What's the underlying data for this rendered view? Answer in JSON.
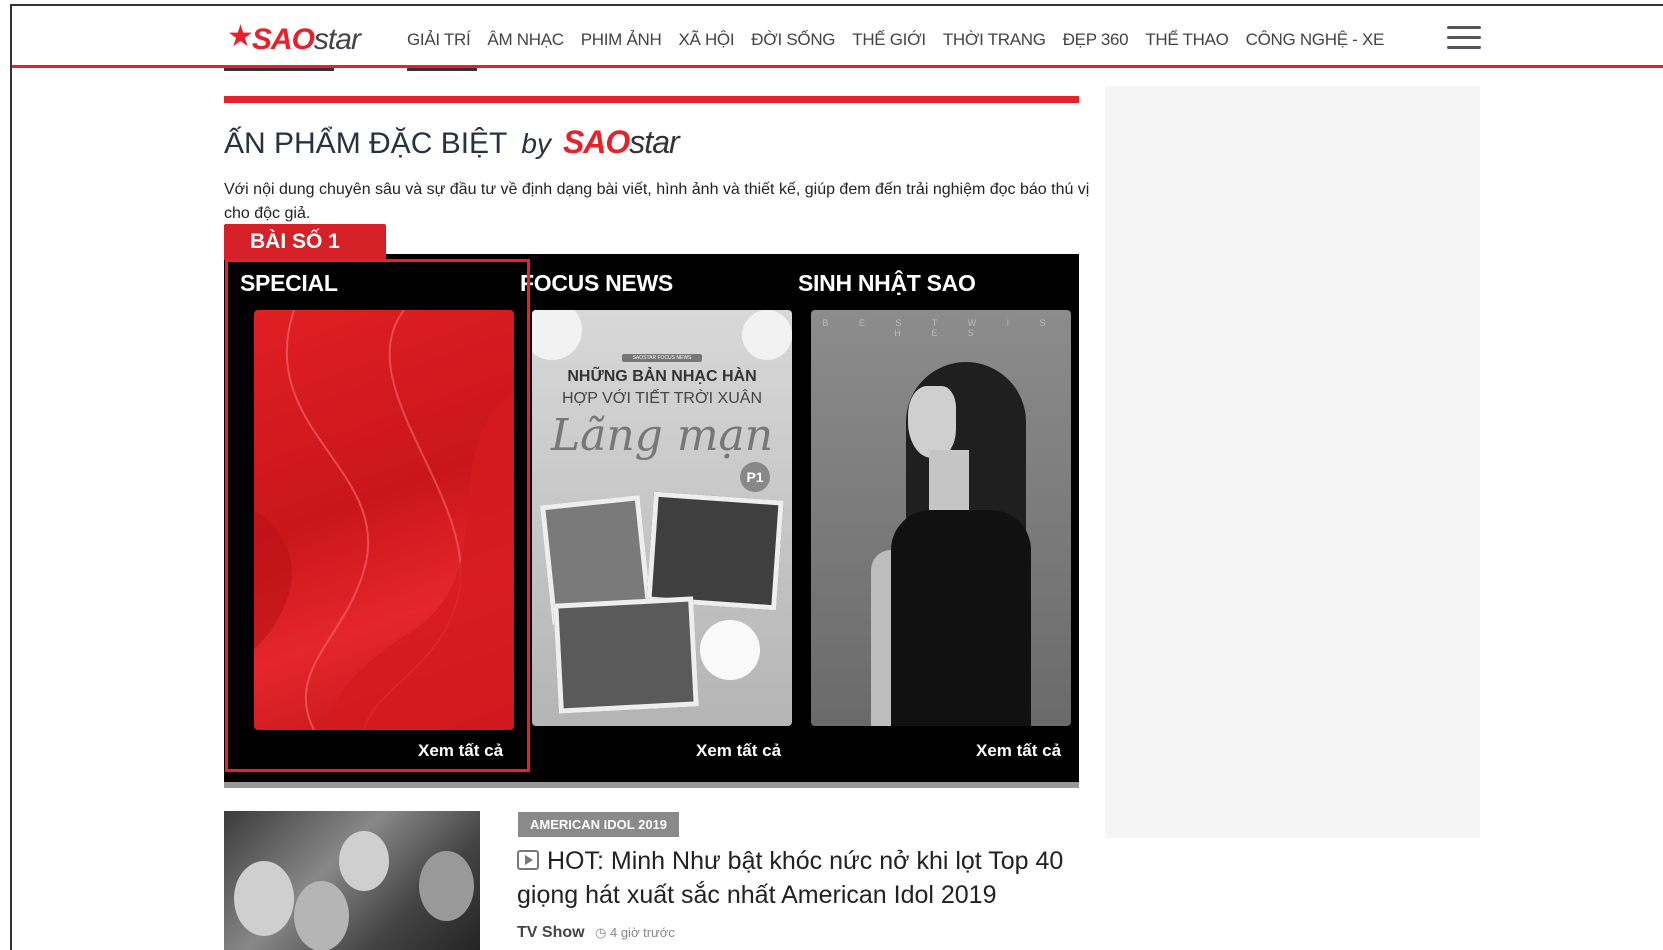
{
  "header": {
    "logo_sao": "SAO",
    "logo_star": "star",
    "nav": [
      "GIẢI TRÍ",
      "ÂM NHẠC",
      "PHIM ẢNH",
      "XÃ HỘI",
      "ĐỜI SỐNG",
      "THẾ GIỚI",
      "THỜI TRANG",
      "ĐẸP 360",
      "THỂ THAO",
      "CÔNG NGHỆ - XE"
    ]
  },
  "special": {
    "title": "ẤN PHẨM ĐẶC BIỆT",
    "by": "by",
    "brand_sao": "SAO",
    "brand_star": "star",
    "description": "Với nội dung chuyên sâu và sự đầu tư về định dạng bài viết, hình ảnh và thiết kế, giúp đem đến trải nghiệm đọc báo thú vị cho độc giả.",
    "tag": "BÀI SỐ 1",
    "columns": [
      {
        "title": "SPECIAL",
        "see_all": "Xem tất cả"
      },
      {
        "title": "FOCUS NEWS",
        "see_all": "Xem tất cả"
      },
      {
        "title": "SINH NHẬT SAO",
        "see_all": "Xem tất cả"
      }
    ],
    "focus_card": {
      "small": "SAOSTAR FOCUS NEWS",
      "line1": "NHỮNG BẢN NHẠC HÀN",
      "line2": "HỢP VỚI TIẾT TRỜI XUÂN",
      "script": "Lãng mạn",
      "badge": "P1"
    },
    "birthday_card": {
      "top": "B E S T  W I S H E S"
    }
  },
  "article": {
    "category": "AMERICAN IDOL 2019",
    "title": "HOT: Minh Như bật khóc nức nở khi lọt Top 40 giọng hát xuất sắc nhất American Idol 2019",
    "source": "TV Show",
    "time": "4 giờ trước"
  },
  "colors": {
    "brand_red": "#e8202a",
    "dark_text": "#263240"
  }
}
